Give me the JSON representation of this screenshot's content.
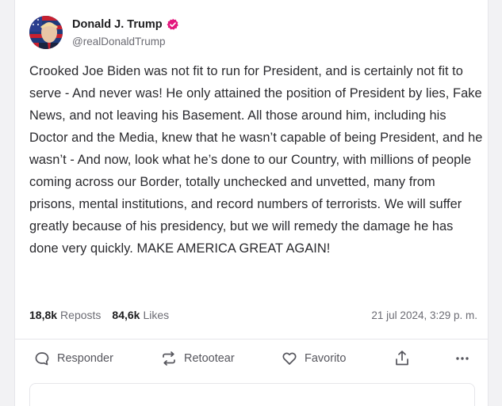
{
  "author": {
    "display_name": "Donald J. Trump",
    "handle": "@realDonaldTrump",
    "verified": true,
    "verified_color": "#e3177d"
  },
  "post": {
    "text": "Crooked Joe Biden was not fit to run for President, and is certainly not fit to serve - And never was! He only attained the position of President by lies, Fake News, and not leaving his Basement. All those around him, including his Doctor and the Media, knew that he wasn’t capable of being President, and he wasn’t - And now, look what he’s done to our Country, with millions of people coming across our Border, totally unchecked and unvetted, many from prisons, mental institutions, and record numbers of terrorists. We will suffer greatly because of his presidency, but we will remedy the damage he has done very quickly. MAKE AMERICA GREAT AGAIN!"
  },
  "stats": {
    "reposts_count": "18,8k",
    "reposts_label": "Reposts",
    "likes_count": "84,6k",
    "likes_label": "Likes",
    "timestamp": "21 jul 2024, 3:29 p. m."
  },
  "actions": {
    "reply_label": "Responder",
    "retweet_label": "Retootear",
    "favorite_label": "Favorito",
    "share_icon": "share-icon",
    "more_icon": "more-icon"
  }
}
